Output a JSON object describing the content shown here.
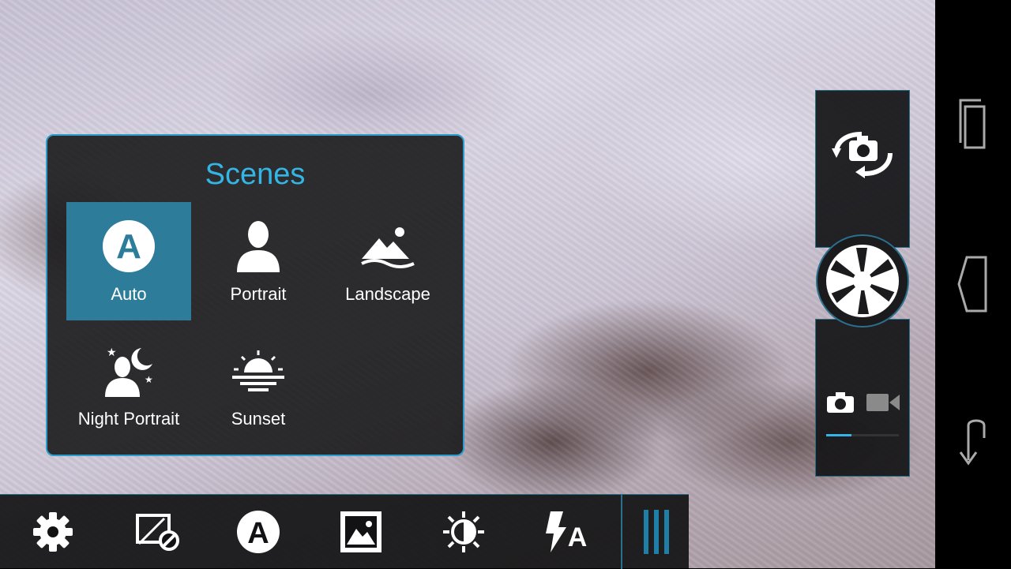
{
  "scenes_panel": {
    "title": "Scenes",
    "items": [
      {
        "label": "Auto",
        "icon": "auto-icon",
        "selected": true
      },
      {
        "label": "Portrait",
        "icon": "portrait-icon",
        "selected": false
      },
      {
        "label": "Landscape",
        "icon": "landscape-icon",
        "selected": false
      },
      {
        "label": "Night Portrait",
        "icon": "night-portrait-icon",
        "selected": false
      },
      {
        "label": "Sunset",
        "icon": "sunset-icon",
        "selected": false
      }
    ]
  },
  "toolbar": {
    "items": [
      {
        "icon": "settings-gear-icon"
      },
      {
        "icon": "exposure-off-icon"
      },
      {
        "icon": "scene-auto-icon"
      },
      {
        "icon": "gallery-icon"
      },
      {
        "icon": "brightness-icon"
      },
      {
        "icon": "flash-auto-icon"
      },
      {
        "icon": "more-menu-icon"
      }
    ]
  },
  "camera_controls": {
    "switch_camera_icon": "switch-camera-icon",
    "shutter_icon": "shutter-aperture-icon",
    "modes": [
      "photo",
      "video"
    ],
    "active_mode": "photo",
    "mode_slider_fraction": 0.35
  },
  "nav_bar": {
    "buttons": [
      "recent-apps-icon",
      "home-icon",
      "back-icon"
    ]
  },
  "colors": {
    "accent": "#33b5e5",
    "selected_scene": "#2d7d9a",
    "panel_border": "#2b9ccc"
  }
}
